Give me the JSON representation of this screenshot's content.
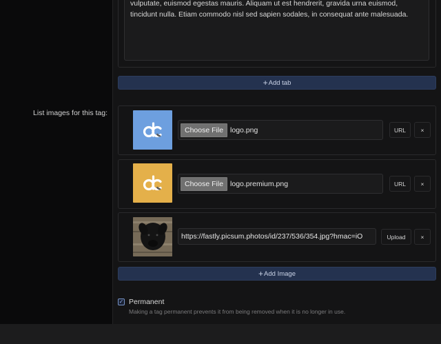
{
  "tab_content": {
    "text": "vulputate, euismod egestas mauris. Aliquam ut est hendrerit, gravida urna euismod, tincidunt nulla. Etiam commodo nisl sed sapien sodales, in consequat ante malesuada."
  },
  "add_tab": {
    "plus": "+",
    "label": "Add tab"
  },
  "list_images": {
    "label": "List images for this tag:",
    "items": [
      {
        "choose_label": "Choose File",
        "file_name": "logo.png",
        "mode_label": "URL",
        "remove_label": "×",
        "thumb_color": "#6d9fdf"
      },
      {
        "choose_label": "Choose File",
        "file_name": "logo.premium.png",
        "mode_label": "URL",
        "remove_label": "×",
        "thumb_color": "#e4b04a"
      },
      {
        "url_value": "https://fastly.picsum.photos/id/237/536/354.jpg?hmac=iO",
        "mode_label": "Upload",
        "remove_label": "×"
      }
    ]
  },
  "add_image": {
    "plus": "+",
    "label": "Add Image"
  },
  "permanent": {
    "checked_glyph": "✓",
    "label": "Permanent",
    "help": "Making a tag permanent prevents it from being removed when it is no longer in use."
  }
}
